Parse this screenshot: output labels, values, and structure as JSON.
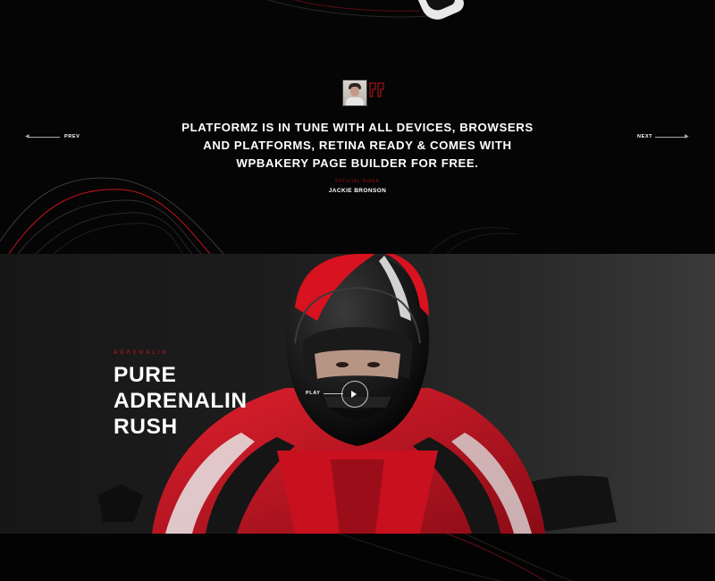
{
  "testimonial": {
    "avatar_icon": "user-avatar-photo",
    "quote_icon": "quote-mark-icon",
    "quote": "Platformz is in tune with all devices, browsers and platforms, retina ready & comes with WPBakery Page Builder for free.",
    "author_role": "Official Rider",
    "author_name": "Jackie Bronson",
    "prev_label": "PREV",
    "next_label": "NEXT",
    "prev_icon": "arrow-left-icon",
    "next_icon": "arrow-right-icon"
  },
  "hero": {
    "eyebrow": "Adrenalin",
    "title": "Pure Adrenalin Rush",
    "play_label": "PLAY",
    "play_icon": "play-icon"
  },
  "colors": {
    "accent": "#c4121f",
    "background": "#050505",
    "text": "#ffffff"
  }
}
